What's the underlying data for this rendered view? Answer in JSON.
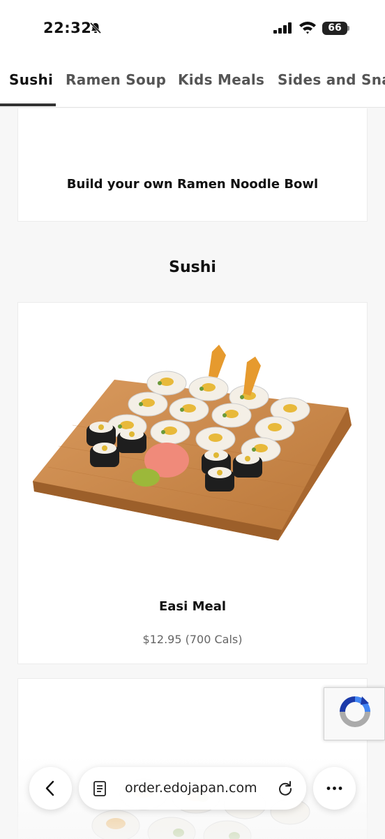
{
  "status_bar": {
    "time": "22:32",
    "battery": "66",
    "icons": [
      "bell-muted-icon",
      "signal-icon",
      "wifi-icon",
      "battery-icon"
    ]
  },
  "tabs": [
    {
      "label": "Sushi",
      "active": true
    },
    {
      "label": "Ramen Soup",
      "active": false
    },
    {
      "label": "Kids Meals",
      "active": false
    },
    {
      "label": "Sides and Snac",
      "active": false
    }
  ],
  "previous_item": {
    "name": "Build your own Ramen Noodle Bowl"
  },
  "section": {
    "heading": "Sushi"
  },
  "items": [
    {
      "name": "Easi Meal",
      "price": "$12.95 (700 Cals)"
    }
  ],
  "browser": {
    "url": "order.edojapan.com",
    "icons": [
      "back-icon",
      "reader-icon",
      "reload-icon",
      "more-icon"
    ]
  },
  "colors": {
    "accent": "#333333",
    "board": "#c8874c",
    "recaptcha_blue": "#1c3aa9",
    "recaptcha_light": "#4285f4",
    "recaptcha_gray": "#ababab"
  }
}
